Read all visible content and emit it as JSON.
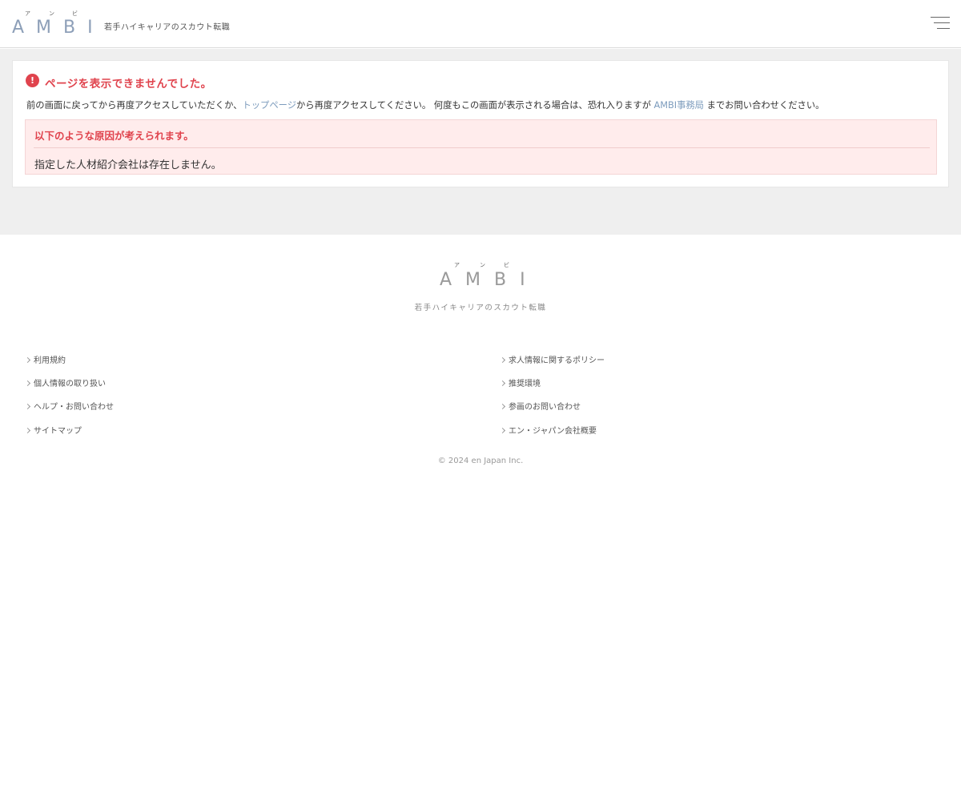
{
  "header": {
    "logo_ruby": [
      "ア",
      "ン",
      "ビ"
    ],
    "logo_text": "AMBI",
    "tagline": "若手ハイキャリアのスカウト転職",
    "menu_icon": "hamburger-menu-icon"
  },
  "error": {
    "icon": "exclamation-circle-icon",
    "title": "ページを表示できませんでした。",
    "desc_before": "前の画面に戻ってから再度アクセスしていただくか、",
    "top_link": "トップページ",
    "desc_middle": "から再度アクセスしてください。 何度もこの画面が表示される場合は、恐れ入りますが ",
    "office_link": "AMBI事務局",
    "desc_after": " までお問い合わせください。",
    "cause_title": "以下のような原因が考えられます。",
    "cause_text": "指定した人材紹介会社は存在しません。"
  },
  "footer": {
    "logo_ruby": [
      "ア",
      "ン",
      "ビ"
    ],
    "logo_text": "AMBI",
    "tagline": "若手ハイキャリアのスカウト転職",
    "links_left": [
      "利用規約",
      "個人情報の取り扱い",
      "ヘルプ・お問い合わせ",
      "サイトマップ"
    ],
    "links_right": [
      "求人情報に関するポリシー",
      "推奨環境",
      "参画のお問い合わせ",
      "エン・ジャパン会社概要"
    ],
    "copyright": "© 2024 en Japan Inc."
  },
  "colors": {
    "accent_red": "#e0434d",
    "link_blue": "#7d9cbd",
    "logo_blue": "#8d9fb8",
    "cause_bg": "#ffecec"
  }
}
